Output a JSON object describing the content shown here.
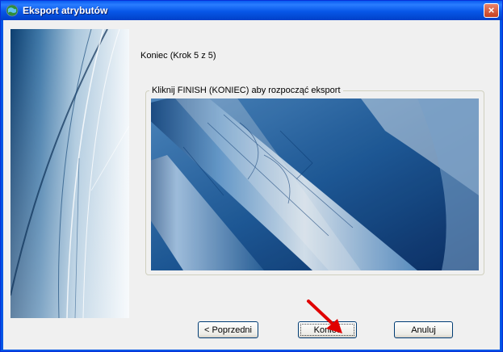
{
  "window": {
    "title": "Eksport atrybutów",
    "close_label": "×"
  },
  "wizard": {
    "step_label": "Koniec (Krok 5 z 5)",
    "group_title": "Kliknij FINISH (KONIEC) aby rozpocząć eksport"
  },
  "buttons": {
    "back": "< Poprzedni",
    "finish": "Koniec",
    "cancel": "Anuluj"
  },
  "colors": {
    "titlebar": "#0a5cf0",
    "annotation_arrow": "#e00000"
  },
  "icons": {
    "app": "globe-icon",
    "close": "close-icon"
  }
}
